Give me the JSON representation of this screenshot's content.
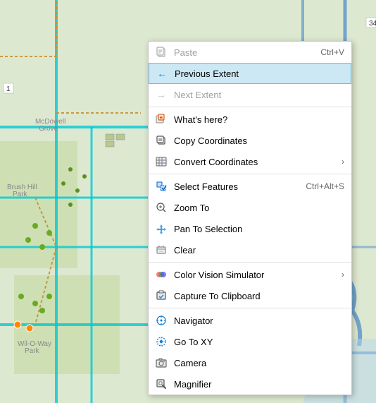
{
  "map": {
    "background_color": "#d8e8c8"
  },
  "context_menu": {
    "items": [
      {
        "id": "paste",
        "label": "Paste",
        "shortcut": "Ctrl+V",
        "icon": "paste-icon",
        "disabled": true,
        "separator_after": false,
        "has_arrow": false,
        "active": false
      },
      {
        "id": "previous-extent",
        "label": "Previous Extent",
        "shortcut": "",
        "icon": "previous-extent-icon",
        "disabled": false,
        "separator_after": false,
        "has_arrow": false,
        "active": true
      },
      {
        "id": "next-extent",
        "label": "Next Extent",
        "shortcut": "",
        "icon": "next-extent-icon",
        "disabled": true,
        "separator_after": true,
        "has_arrow": false,
        "active": false
      },
      {
        "id": "whats-here",
        "label": "What's here?",
        "shortcut": "",
        "icon": "whats-here-icon",
        "disabled": false,
        "separator_after": false,
        "has_arrow": false,
        "active": false
      },
      {
        "id": "copy-coordinates",
        "label": "Copy Coordinates",
        "shortcut": "",
        "icon": "copy-coordinates-icon",
        "disabled": false,
        "separator_after": false,
        "has_arrow": false,
        "active": false
      },
      {
        "id": "convert-coordinates",
        "label": "Convert Coordinates",
        "shortcut": "",
        "icon": "convert-coordinates-icon",
        "disabled": false,
        "separator_after": true,
        "has_arrow": true,
        "active": false
      },
      {
        "id": "select-features",
        "label": "Select Features",
        "shortcut": "Ctrl+Alt+S",
        "icon": "select-features-icon",
        "disabled": false,
        "separator_after": false,
        "has_arrow": false,
        "active": false
      },
      {
        "id": "zoom-to",
        "label": "Zoom To",
        "shortcut": "",
        "icon": "zoom-to-icon",
        "disabled": false,
        "separator_after": false,
        "has_arrow": false,
        "active": false
      },
      {
        "id": "pan-to-selection",
        "label": "Pan To Selection",
        "shortcut": "",
        "icon": "pan-to-selection-icon",
        "disabled": false,
        "separator_after": false,
        "has_arrow": false,
        "active": false
      },
      {
        "id": "clear",
        "label": "Clear",
        "shortcut": "",
        "icon": "clear-icon",
        "disabled": false,
        "separator_after": true,
        "has_arrow": false,
        "active": false
      },
      {
        "id": "color-vision-simulator",
        "label": "Color Vision Simulator",
        "shortcut": "",
        "icon": "color-vision-icon",
        "disabled": false,
        "separator_after": false,
        "has_arrow": true,
        "active": false
      },
      {
        "id": "capture-to-clipboard",
        "label": "Capture To Clipboard",
        "shortcut": "",
        "icon": "capture-clipboard-icon",
        "disabled": false,
        "separator_after": true,
        "has_arrow": false,
        "active": false
      },
      {
        "id": "navigator",
        "label": "Navigator",
        "shortcut": "",
        "icon": "navigator-icon",
        "disabled": false,
        "separator_after": false,
        "has_arrow": false,
        "active": false
      },
      {
        "id": "go-to-xy",
        "label": "Go To XY",
        "shortcut": "",
        "icon": "go-to-xy-icon",
        "disabled": false,
        "separator_after": false,
        "has_arrow": false,
        "active": false
      },
      {
        "id": "camera",
        "label": "Camera",
        "shortcut": "",
        "icon": "camera-icon",
        "disabled": false,
        "separator_after": false,
        "has_arrow": false,
        "active": false
      },
      {
        "id": "magnifier",
        "label": "Magnifier",
        "shortcut": "",
        "icon": "magnifier-icon",
        "disabled": false,
        "separator_after": false,
        "has_arrow": false,
        "active": false
      }
    ]
  }
}
